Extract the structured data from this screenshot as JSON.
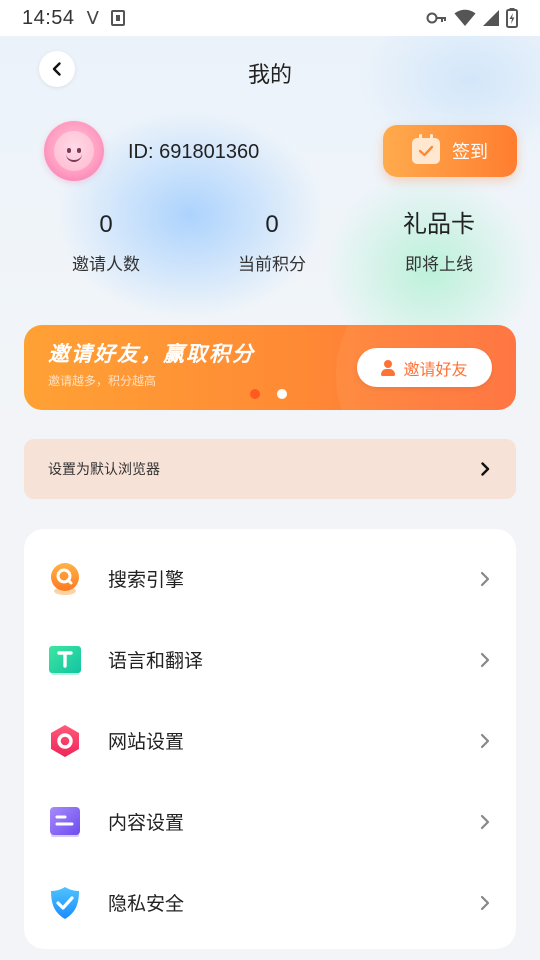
{
  "status_bar": {
    "time": "14:54",
    "v_glyph": "V"
  },
  "header": {
    "title": "我的"
  },
  "profile": {
    "id_text": "ID: 691801360",
    "checkin_label": "签到"
  },
  "stats": [
    {
      "value": "0",
      "label": "邀请人数"
    },
    {
      "value": "0",
      "label": "当前积分"
    },
    {
      "value": "礼品卡",
      "label": "即将上线"
    }
  ],
  "banner": {
    "title": "邀请好友，赢取积分",
    "subtitle": "邀请越多，积分越高",
    "button_label": "邀请好友",
    "active_slide": 2,
    "slide_count": 2
  },
  "default_browser": {
    "label": "设置为默认浏览器"
  },
  "menu": {
    "items": [
      {
        "label": "搜索引擎",
        "icon": "search-engine-icon"
      },
      {
        "label": "语言和翻译",
        "icon": "translate-icon"
      },
      {
        "label": "网站设置",
        "icon": "website-settings-icon"
      },
      {
        "label": "内容设置",
        "icon": "content-settings-icon"
      },
      {
        "label": "隐私安全",
        "icon": "privacy-shield-icon"
      }
    ]
  },
  "colors": {
    "accent_orange": "#ff7d2f",
    "banner_start": "#ffa135",
    "banner_end": "#ff6e38",
    "default_row_bg": "#f7e2d7"
  }
}
